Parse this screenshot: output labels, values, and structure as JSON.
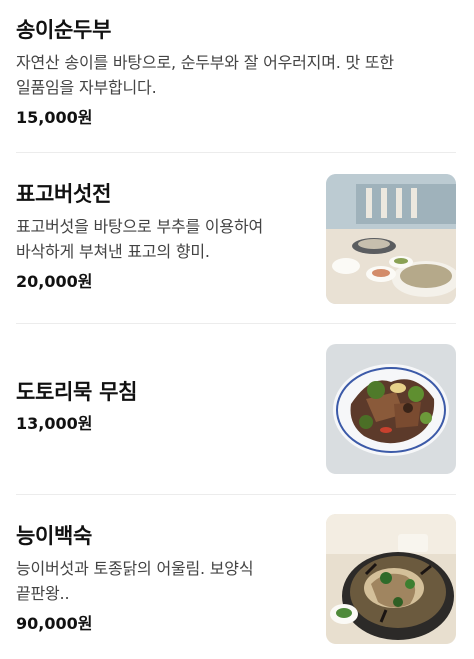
{
  "menu": [
    {
      "name": "송이순두부",
      "desc1": "자연산 송이를 바탕으로, 순두부와 잘 어우러지며. 맛 또한",
      "desc2": "일품임을 자부합니다.",
      "price": "15,000원"
    },
    {
      "name": "표고버섯전",
      "desc1": "표고버섯을 바탕으로 부추를 이용하여",
      "desc2": "바삭하게 부쳐낸 표고의 향미.",
      "price": "20,000원"
    },
    {
      "name": "도토리묵 무침",
      "price": "13,000원"
    },
    {
      "name": "능이백숙",
      "desc1": "능이버섯과 토종닭의 어울림. 보양식",
      "desc2": "끝판왕..",
      "price": "90,000원"
    }
  ]
}
